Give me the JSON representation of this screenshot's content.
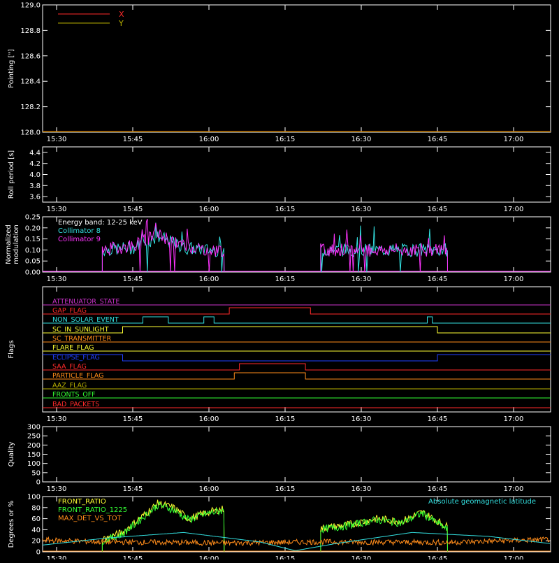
{
  "colors": {
    "background": "#000000",
    "axes": "#ffffff",
    "x_series": "#ff2a2a",
    "y_series": "#b8b000",
    "collimator8": "#33e0e0",
    "collimator9": "#ff33ff",
    "front_ratio": "#ffff33",
    "front_ratio_1225": "#33ff33",
    "max_det": "#ff8c1a",
    "latitude": "#33e0e0"
  },
  "time_ticks": [
    "15:30",
    "15:45",
    "16:00",
    "16:15",
    "16:30",
    "16:45",
    "17:00"
  ],
  "chart_data": [
    {
      "type": "line",
      "panel": "pointing",
      "ylabel": "Pointing [\"]",
      "ylim": [
        128.0,
        129.0
      ],
      "y_ticks": [
        "128.0",
        "128.2",
        "128.4",
        "128.6",
        "128.8",
        "129.0"
      ],
      "x_range": [
        "15:25",
        "17:10"
      ],
      "legend": "top-left",
      "series": [
        {
          "name": "X",
          "color": "#ff2a2a",
          "x": [
            "15:25",
            "17:10"
          ],
          "values": [
            128.0,
            128.0
          ]
        },
        {
          "name": "Y",
          "color": "#b8b000",
          "x": [
            "15:25",
            "17:10"
          ],
          "values": [
            128.0,
            128.0
          ]
        }
      ]
    },
    {
      "type": "line",
      "panel": "roll",
      "ylabel": "Roll period [s]",
      "ylim": [
        3.5,
        4.5
      ],
      "y_ticks": [
        "3.6",
        "3.8",
        "4.0",
        "4.2",
        "4.4"
      ],
      "series": []
    },
    {
      "type": "line",
      "panel": "modulation",
      "ylabel": "Normalized\nmodulation",
      "ylim": [
        0,
        0.25
      ],
      "y_ticks": [
        "0.00",
        "0.05",
        "0.10",
        "0.15",
        "0.20",
        "0.25"
      ],
      "annotation": "Energy band: 12-25 keV",
      "legend": "top-left",
      "series": [
        {
          "name": "Collimator 8",
          "color": "#33e0e0",
          "x": [
            "15:39",
            "15:45",
            "15:50",
            "15:55",
            "16:00",
            "16:03",
            "16:22",
            "16:30",
            "16:40",
            "16:47"
          ],
          "values": [
            0.1,
            0.11,
            0.16,
            0.11,
            0.1,
            0.1,
            0.1,
            0.1,
            0.1,
            0.1
          ]
        },
        {
          "name": "Collimator 9",
          "color": "#ff33ff",
          "x": [
            "15:39",
            "15:45",
            "15:50",
            "15:55",
            "16:00",
            "16:03",
            "16:22",
            "16:30",
            "16:40",
            "16:47"
          ],
          "values": [
            0.1,
            0.12,
            0.17,
            0.12,
            0.1,
            0.1,
            0.1,
            0.1,
            0.1,
            0.1
          ]
        }
      ]
    },
    {
      "type": "line",
      "panel": "flags",
      "ylabel": "Flags",
      "series": [
        {
          "name": "ATTENUATOR_STATE",
          "color": "#cc33cc",
          "on": []
        },
        {
          "name": "GAP_FLAG",
          "color": "#ff2a2a",
          "on": [
            [
              "16:04",
              "16:20"
            ]
          ]
        },
        {
          "name": "NON_SOLAR_EVENT",
          "color": "#33e0e0",
          "on": [
            [
              "15:47",
              "15:52"
            ],
            [
              "15:59",
              "16:01"
            ],
            [
              "16:43",
              "16:44"
            ]
          ]
        },
        {
          "name": "SC_IN_SUNLIGHT",
          "color": "#ffff33",
          "on": [
            [
              "15:43",
              "16:45"
            ]
          ]
        },
        {
          "name": "SC_TRANSMITTER",
          "color": "#ff8c1a",
          "on": []
        },
        {
          "name": "FLARE_FLAG",
          "color": "#ffff33",
          "on": []
        },
        {
          "name": "ECLIPSE_FLAG",
          "color": "#2040ff",
          "on": [
            [
              "15:25",
              "15:43"
            ],
            [
              "16:45",
              "17:10"
            ]
          ]
        },
        {
          "name": "SAA_FLAG",
          "color": "#ff2a2a",
          "on": [
            [
              "16:06",
              "16:19"
            ]
          ]
        },
        {
          "name": "PARTICLE_FLAG",
          "color": "#ff8c1a",
          "on": [
            [
              "16:05",
              "16:19"
            ]
          ]
        },
        {
          "name": "AAZ_FLAG",
          "color": "#b8b000",
          "on": []
        },
        {
          "name": "FRONTS_OFF",
          "color": "#33ff33",
          "on": []
        },
        {
          "name": "BAD_PACKETS",
          "color": "#ff2a2a",
          "on": []
        }
      ]
    },
    {
      "type": "line",
      "panel": "quality",
      "ylabel": "Quality",
      "ylim": [
        0,
        300
      ],
      "y_ticks": [
        "0",
        "50",
        "100",
        "150",
        "200",
        "250",
        "300"
      ],
      "series": []
    },
    {
      "type": "line",
      "panel": "ratios",
      "ylabel": "Degrees or %",
      "ylim": [
        0,
        100
      ],
      "y_ticks": [
        "0",
        "20",
        "40",
        "60",
        "80",
        "100"
      ],
      "right_legend": "Absolute geomagnetic latitude",
      "legend": "top-left",
      "series": [
        {
          "name": "FRONT_RATIO",
          "color": "#ffff33",
          "x": [
            "15:39",
            "15:43",
            "15:47",
            "15:50",
            "15:53",
            "15:56",
            "16:00",
            "16:03",
            "16:22",
            "16:28",
            "16:33",
            "16:38",
            "16:42",
            "16:47"
          ],
          "values": [
            22,
            35,
            65,
            88,
            80,
            60,
            72,
            78,
            42,
            50,
            60,
            55,
            72,
            45
          ]
        },
        {
          "name": "FRONT_RATIO_1225",
          "color": "#33ff33",
          "x": [
            "15:39",
            "15:43",
            "15:47",
            "15:50",
            "15:53",
            "15:56",
            "16:00",
            "16:03",
            "16:22",
            "16:28",
            "16:33",
            "16:38",
            "16:42",
            "16:47"
          ],
          "values": [
            20,
            32,
            62,
            85,
            76,
            58,
            70,
            75,
            40,
            48,
            58,
            52,
            70,
            40
          ]
        },
        {
          "name": "MAX_DET_VS_TOT",
          "color": "#ff8c1a",
          "x": [
            "15:25",
            "15:39",
            "16:03",
            "16:22",
            "16:47",
            "17:10"
          ],
          "values": [
            22,
            18,
            16,
            18,
            17,
            23
          ]
        },
        {
          "name": "Absolute geomagnetic latitude",
          "color": "#33e0e0",
          "x": [
            "15:25",
            "15:40",
            "15:55",
            "16:10",
            "16:17",
            "16:25",
            "16:40",
            "16:55",
            "17:10"
          ],
          "values": [
            10,
            25,
            35,
            18,
            2,
            15,
            35,
            28,
            12
          ]
        }
      ]
    }
  ]
}
